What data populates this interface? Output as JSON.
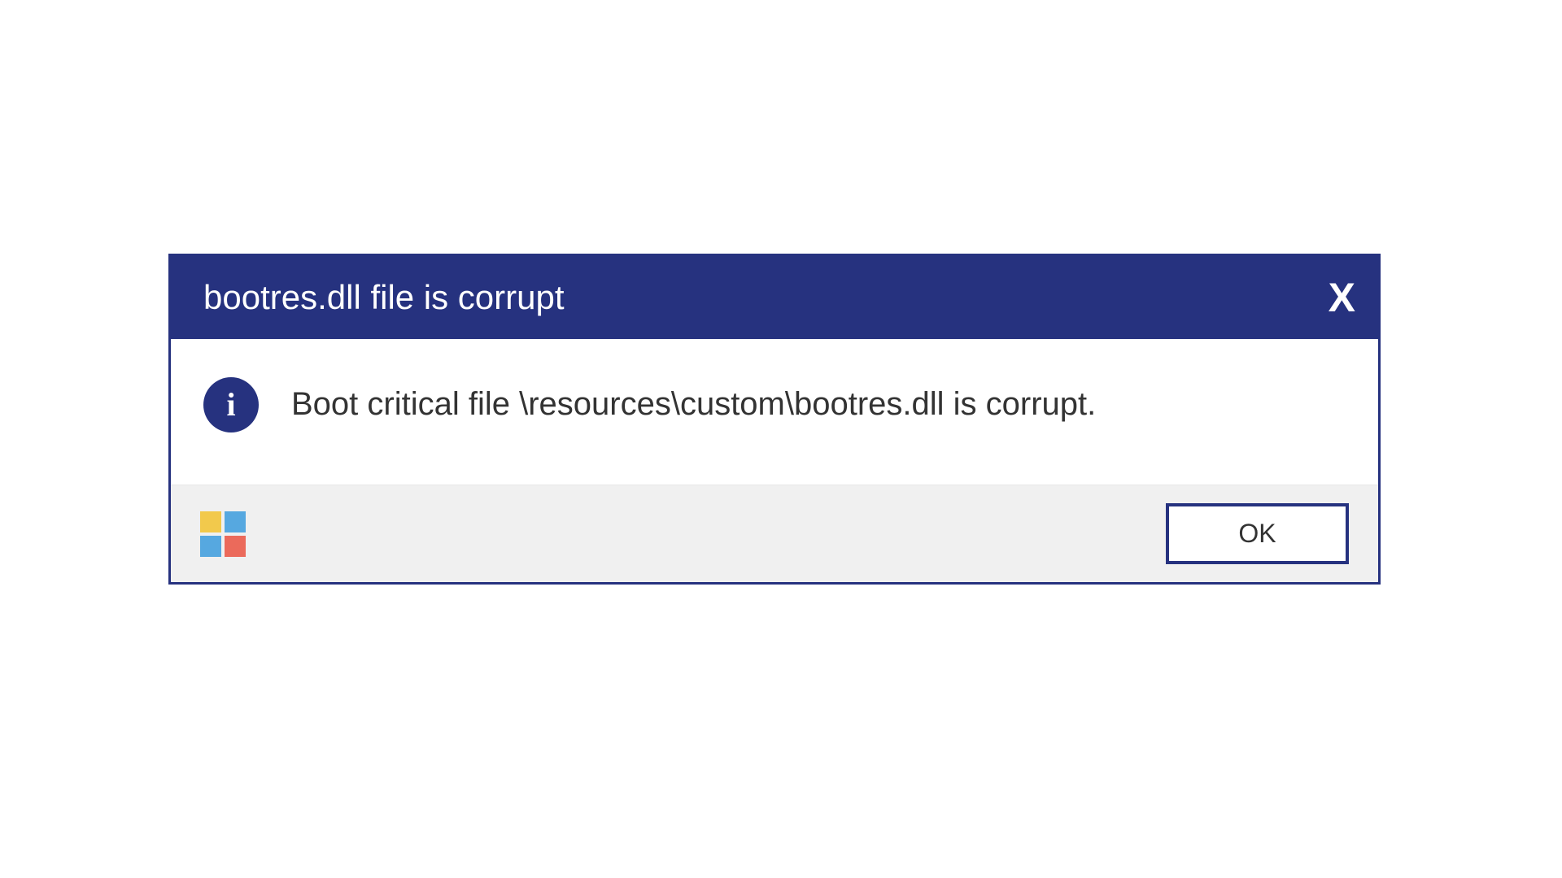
{
  "dialog": {
    "title": "bootres.dll file is corrupt",
    "close_label": "X",
    "info_glyph": "i",
    "message": "Boot critical file \\resources\\custom\\bootres.dll is corrupt.",
    "ok_label": "OK"
  },
  "colors": {
    "accent": "#26327f",
    "logo_yellow": "#f2c94c",
    "logo_blue": "#56a8e0",
    "logo_red": "#eb6a5b"
  }
}
